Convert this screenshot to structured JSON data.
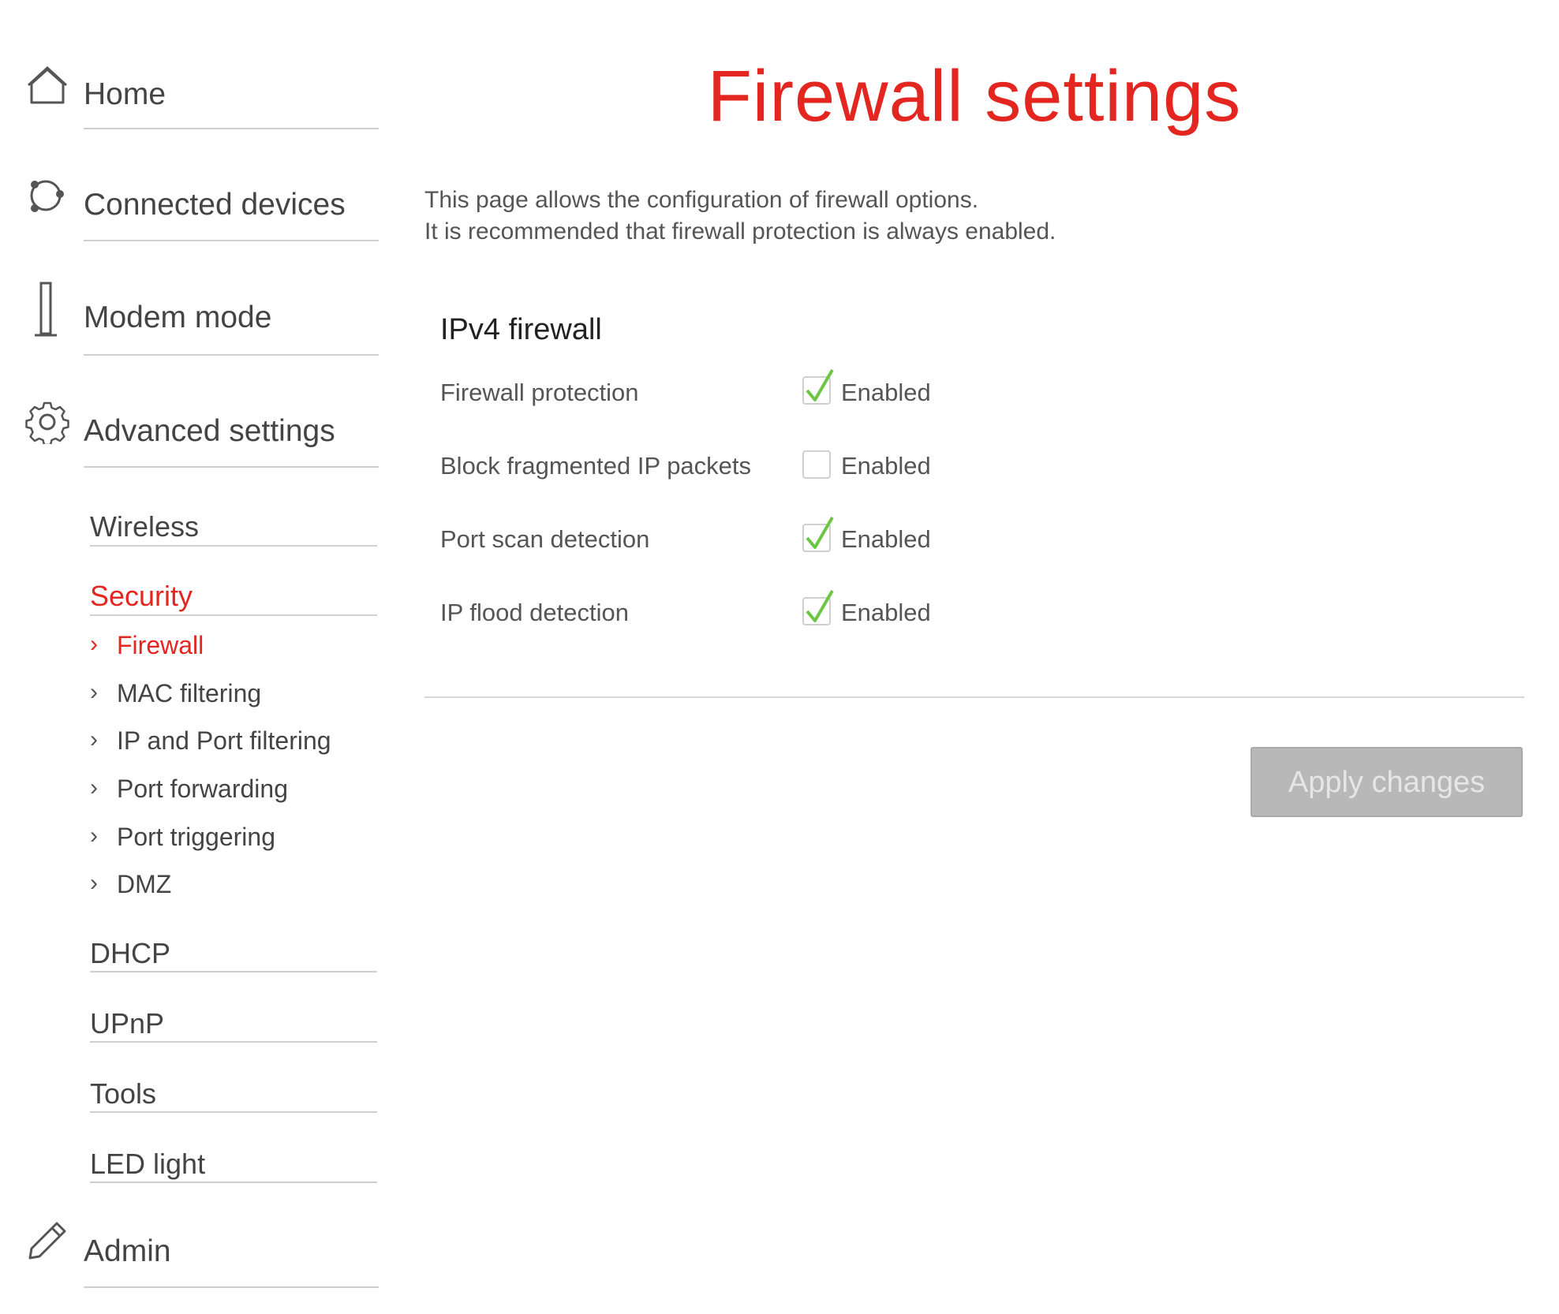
{
  "sidebar": {
    "main": [
      {
        "label": "Home",
        "icon": "home-icon"
      },
      {
        "label": "Connected devices",
        "icon": "connected-devices-icon"
      },
      {
        "label": "Modem mode",
        "icon": "modem-icon"
      },
      {
        "label": "Advanced settings",
        "icon": "gear-icon"
      },
      {
        "label": "Admin",
        "icon": "pencil-icon"
      }
    ],
    "sub": [
      {
        "label": "Wireless"
      },
      {
        "label": "Security",
        "active": true
      },
      {
        "label": "DHCP"
      },
      {
        "label": "UPnP"
      },
      {
        "label": "Tools"
      },
      {
        "label": "LED light"
      }
    ],
    "security_items": [
      {
        "label": "Firewall",
        "active": true
      },
      {
        "label": "MAC filtering"
      },
      {
        "label": "IP and Port filtering"
      },
      {
        "label": "Port forwarding"
      },
      {
        "label": "Port triggering"
      },
      {
        "label": "DMZ"
      }
    ],
    "chevron": "›"
  },
  "main": {
    "title": "Firewall settings",
    "description": [
      "This page allows the configuration of firewall options.",
      "It is recommended that firewall protection is always enabled."
    ],
    "section_title": "IPv4 firewall",
    "options": [
      {
        "label": "Firewall protection",
        "checkbox_label": "Enabled",
        "checked": true
      },
      {
        "label": "Block fragmented IP packets",
        "checkbox_label": "Enabled",
        "checked": false
      },
      {
        "label": "Port scan detection",
        "checkbox_label": "Enabled",
        "checked": true
      },
      {
        "label": "IP flood detection",
        "checkbox_label": "Enabled",
        "checked": true
      }
    ],
    "apply_label": "Apply changes"
  },
  "colors": {
    "accent": "#e3261f",
    "check": "#6cc644",
    "button_disabled": "#b8b8b8"
  }
}
